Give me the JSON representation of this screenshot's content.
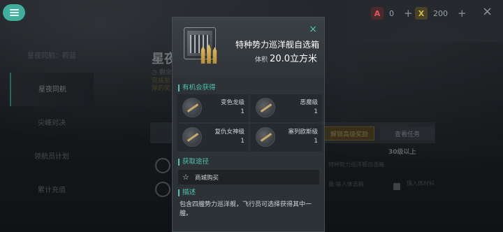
{
  "topbar": {
    "currency1": {
      "icon": "A",
      "value": "0",
      "color": "#e05a5a"
    },
    "currency2": {
      "icon": "X",
      "value": "200",
      "color": "#d7b64a"
    },
    "plus": "+",
    "close": "×"
  },
  "sidebar": {
    "items": [
      {
        "label": "星夜同航：蔚蓝"
      },
      {
        "label": "星夜同航"
      },
      {
        "label": "尖峰对决"
      },
      {
        "label": "领航员计划"
      },
      {
        "label": "累计充值"
      }
    ]
  },
  "background": {
    "title": "星夜",
    "sub1": "◷ 剩余",
    "sub2": "完成星",
    "sub3": "厚的奖",
    "unlock_button": "解锁高级奖励",
    "task_button": "查看任务",
    "level_text": "30级以上",
    "note1": "特种势力巡洋舰自选箱",
    "note2": "量·输入体选箱",
    "note3": "镶入体材料"
  },
  "modal": {
    "item_name": "特种势力巡洋舰自选箱",
    "volume_label": "体积",
    "volume_value": "20.0立方米",
    "section_obtain": "有机会获得",
    "rewards": [
      {
        "name": "变色龙级",
        "count": "1"
      },
      {
        "name": "恶魔级",
        "count": "1"
      },
      {
        "name": "复仇女神级",
        "count": "1"
      },
      {
        "name": "塞列欧斯级",
        "count": "1"
      }
    ],
    "section_source": "获取途径",
    "source_item": "商城购买",
    "section_desc": "描述",
    "description": "包含四艘势力巡洋舰，飞行员可选择获得其中一艘。"
  }
}
